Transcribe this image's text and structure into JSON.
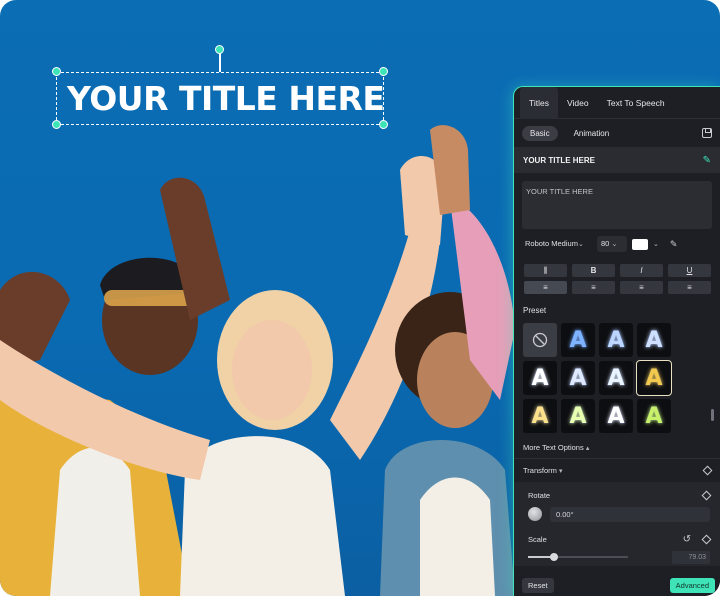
{
  "canvas": {
    "title_text": "YOUR TITLE HERE"
  },
  "panel": {
    "tabs": [
      {
        "label": "Titles",
        "active": true
      },
      {
        "label": "Video",
        "active": false
      },
      {
        "label": "Text To Speech",
        "active": false
      }
    ],
    "subtabs": [
      {
        "label": "Basic",
        "active": true
      },
      {
        "label": "Animation",
        "active": false
      }
    ],
    "header_title": "YOUR TITLE HERE",
    "text_value": "YOUR TITLE HERE",
    "font": "Roboto Medium",
    "font_size": "80",
    "text_color": "#ffffff",
    "format_buttons": [
      "spacing",
      "B",
      "I",
      "U",
      "align-left",
      "align-center",
      "align-right",
      "align-justify"
    ],
    "preset_label": "Preset",
    "presets": [
      {
        "style": "none"
      },
      {
        "style": "A-blue-outline",
        "color": "#7fb3ff"
      },
      {
        "style": "A-white-blue",
        "color": "#bcd6ff"
      },
      {
        "style": "A-navy",
        "color": "#cfe0ff"
      },
      {
        "style": "A-white-glow",
        "color": "#ffffff"
      },
      {
        "style": "A-blue-neon",
        "color": "#dfe9ff"
      },
      {
        "style": "A-cyan-pink",
        "color": "#eaf4ff"
      },
      {
        "style": "A-gold-selected",
        "color": "#f2c94c",
        "selected": true
      },
      {
        "style": "A-yellow",
        "color": "#ffe08a"
      },
      {
        "style": "A-lime",
        "color": "#e9ffb0"
      },
      {
        "style": "A-white-dark",
        "color": "#ffffff"
      },
      {
        "style": "A-green-yellow",
        "color": "#c8f06a"
      }
    ],
    "more_text_options": "More Text Options",
    "transform_label": "Transform",
    "rotate_label": "Rotate",
    "rotate_value": "0.00°",
    "scale_label": "Scale",
    "scale_value": "79.03",
    "scale_fraction": 0.26,
    "reset_label": "Reset",
    "advanced_label": "Advanced"
  },
  "colors": {
    "accent": "#3ee3b8",
    "sky": "#0b6db4",
    "panel_bg": "#1d1f24"
  }
}
